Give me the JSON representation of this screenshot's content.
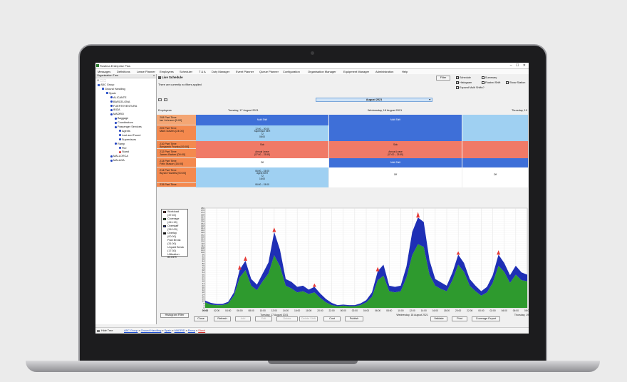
{
  "app": {
    "title": "Rostima Enterprise Plus",
    "icon": "app-icon",
    "window_controls": "–  ☐  ✕"
  },
  "menu": [
    "Messages",
    "Definitions",
    "Leave Planner",
    "Employees",
    "Scheduler",
    "T & A",
    "Duty Manager",
    "Event Planner",
    "Queue Planner",
    "Configuration",
    "Organisation Manager",
    "Equipment Manager",
    "Administration",
    "Help"
  ],
  "tree": {
    "header": "Organisation Tree",
    "close": "x",
    "tools": "⊕ ⬚ ⬚",
    "nodes": [
      {
        "label": "ABC Group",
        "depth": 0,
        "icon": "folder"
      },
      {
        "label": "Ground Handling",
        "depth": 1,
        "icon": "folder"
      },
      {
        "label": "Spain",
        "depth": 2,
        "icon": "folder"
      },
      {
        "label": "ALICANTE",
        "depth": 3,
        "icon": "dot"
      },
      {
        "label": "BARCELONA",
        "depth": 3,
        "icon": "dot"
      },
      {
        "label": "FUERTEVENTURA",
        "depth": 3,
        "icon": "dot"
      },
      {
        "label": "IBIZA",
        "depth": 3,
        "icon": "dot"
      },
      {
        "label": "MADRID",
        "depth": 3,
        "icon": "dot"
      },
      {
        "label": "Baggage",
        "depth": 4,
        "icon": "dot"
      },
      {
        "label": "Coordinators",
        "depth": 4,
        "icon": "dot"
      },
      {
        "label": "Passenger Services",
        "depth": 4,
        "icon": "dot"
      },
      {
        "label": "Agents",
        "depth": 5,
        "icon": "dot"
      },
      {
        "label": "Lost and Found",
        "depth": 5,
        "icon": "dot"
      },
      {
        "label": "Supervisors",
        "depth": 5,
        "icon": "dot"
      },
      {
        "label": "Ramp",
        "depth": 4,
        "icon": "dot"
      },
      {
        "label": "Pier",
        "depth": 5,
        "icon": "dot"
      },
      {
        "label": "Stand",
        "depth": 5,
        "icon": "red"
      },
      {
        "label": "MALLORCA",
        "depth": 3,
        "icon": "dot"
      },
      {
        "label": "MALAGA",
        "depth": 3,
        "icon": "dot"
      }
    ]
  },
  "schedule": {
    "title": "Live Schedule",
    "filter_message": "There are currently no filters applied",
    "filter_button": "Filter",
    "options": [
      {
        "label": "Schedule",
        "checked": true
      },
      {
        "label": "Summary",
        "checked": false
      },
      {
        "label": "Histogram",
        "checked": true
      },
      {
        "label": "Floated Shift",
        "checked": false
      },
      {
        "label": "Show Station",
        "checked": false
      },
      {
        "label": "Expand Multi Shifts?",
        "checked": false
      }
    ],
    "month": "August 2021",
    "employees_header": "Employees",
    "day_headers": [
      "Tuesday, 17 August 2021",
      "Wednesday, 18 August 2021",
      "Thursday, 19"
    ],
    "employees": [
      {
        "line1": "208 Part Time",
        "line2": "Ian Johnson [0:00]"
      },
      {
        "line1": "209 Part Time",
        "line2": "Mark Davies [24:00]"
      },
      {
        "line1": "210 Part Time",
        "line2": "Benjamin Franks [00:00]"
      },
      {
        "line1": "212 Part Time",
        "line2": "James Barker [00:00]"
      },
      {
        "line1": "213 Part Time",
        "line2": "Felix Mason [16:00]"
      },
      {
        "line1": "214 Part Time",
        "line2": "Bryan Howells [00:00]"
      },
      {
        "line1": "215 Part Time",
        "line2": ""
      }
    ],
    "shift_text": {
      "multi_shift": "Multi Shift",
      "sick": "Sick",
      "annual_leave": "Annual Leave",
      "annual_time": "[07:00 – 23:59]",
      "off": "Off",
      "sup_lines": [
        "12:00 – 20:00",
        "Supervisor KEH",
        "T2",
        "08:00"
      ],
      "agent_lines": [
        "06:00 – 15:00",
        "Agent KEH",
        "T2",
        "16:00"
      ],
      "cut_time": "06:00 – 15:00"
    }
  },
  "legend": [
    {
      "label": "Workload",
      "value": "(37:40)",
      "color": "#e53935"
    },
    {
      "label": "Coverage",
      "value": "(411:15)",
      "color": "#2e9a2e"
    },
    {
      "label": "Overstaff",
      "value": "(310:00)",
      "color": "#1e2fb5"
    },
    {
      "label": "Overlay",
      "value": "(00:00)",
      "color": "#111111"
    },
    {
      "label": "Paid Break",
      "value": "(31:00)",
      "color": ""
    },
    {
      "label": "Unpaid Break",
      "value": "(17:30)",
      "color": ""
    },
    {
      "label": "Utilization: 80.81%",
      "value": "",
      "color": ""
    }
  ],
  "histogram_filter": "Histogram Filter",
  "chart_data": {
    "type": "area",
    "title": "",
    "xlabel": "",
    "ylabel": "",
    "ylim": [
      0,
      180
    ],
    "yticks": [
      0,
      4,
      8,
      12,
      16,
      20,
      24,
      28,
      32,
      36,
      40,
      44,
      48,
      52,
      56,
      60,
      64,
      68,
      72,
      76,
      80,
      84,
      88,
      92,
      96,
      100,
      104,
      108,
      112,
      116,
      120,
      124,
      128,
      132,
      136,
      140,
      144,
      148,
      152,
      156,
      160,
      164,
      168,
      172,
      176,
      180
    ],
    "x_labels": [
      "00:00",
      "02:00",
      "04:00",
      "06:00",
      "08:00",
      "10:00",
      "12:00",
      "14:00",
      "16:00",
      "18:00",
      "20:00",
      "22:00",
      "00:00",
      "02:00",
      "04:00",
      "06:00",
      "08:00",
      "10:00",
      "12:00",
      "14:00",
      "16:00",
      "18:00",
      "20:00",
      "22:00",
      "00:00",
      "02:00",
      "04:00",
      "06:00",
      "08:00"
    ],
    "day_labels": [
      "Tuesday, 17 August 2021",
      "Wednesday, 18 August 2021",
      "Thursday, 19"
    ],
    "x_hours": [
      0,
      1,
      2,
      3,
      4,
      5,
      6,
      7,
      8,
      9,
      10,
      11,
      12,
      13,
      14,
      15,
      16,
      17,
      18,
      19,
      20,
      21,
      22,
      23,
      24,
      25,
      26,
      27,
      28,
      29,
      30,
      31,
      32,
      33,
      34,
      35,
      36,
      37,
      38,
      39,
      40,
      41,
      42,
      43,
      44,
      45,
      46,
      47,
      48,
      49,
      50,
      51,
      52,
      53,
      54,
      55,
      56
    ],
    "series": [
      {
        "name": "Coverage",
        "color": "#2e9a2e",
        "values": [
          10,
          6,
          5,
          5,
          8,
          22,
          55,
          68,
          40,
          32,
          48,
          62,
          95,
          75,
          40,
          35,
          28,
          30,
          25,
          28,
          18,
          10,
          5,
          3,
          4,
          3,
          3,
          5,
          10,
          20,
          50,
          58,
          30,
          28,
          30,
          55,
          95,
          115,
          110,
          60,
          40,
          34,
          30,
          50,
          78,
          65,
          40,
          30,
          22,
          28,
          45,
          76,
          65,
          45,
          60,
          50,
          48
        ]
      },
      {
        "name": "Overstaff",
        "color": "#1e2fb5",
        "values": [
          3,
          3,
          2,
          2,
          3,
          6,
          14,
          17,
          12,
          10,
          14,
          20,
          42,
          30,
          12,
          12,
          10,
          10,
          8,
          10,
          8,
          6,
          4,
          2,
          2,
          2,
          2,
          3,
          4,
          8,
          16,
          20,
          10,
          10,
          10,
          20,
          42,
          48,
          45,
          26,
          12,
          12,
          10,
          14,
          18,
          16,
          12,
          10,
          8,
          10,
          14,
          20,
          16,
          14,
          16,
          14,
          12
        ]
      },
      {
        "name": "Workload",
        "color": "#e53935",
        "values": [
          0,
          0,
          0,
          0,
          0,
          0,
          8,
          8,
          0,
          0,
          0,
          0,
          8,
          0,
          0,
          0,
          0,
          0,
          0,
          6,
          0,
          0,
          0,
          0,
          0,
          0,
          0,
          0,
          0,
          0,
          8,
          0,
          0,
          0,
          0,
          0,
          0,
          10,
          0,
          0,
          0,
          0,
          0,
          0,
          6,
          0,
          0,
          0,
          0,
          0,
          0,
          8,
          0,
          0,
          0,
          0,
          0
        ]
      }
    ],
    "grid": true,
    "legend": "left"
  },
  "buttons": [
    {
      "label": "Close",
      "enabled": true
    },
    {
      "label": "Refresh",
      "enabled": true
    },
    {
      "label": "Add",
      "enabled": false
    },
    {
      "label": "Edit",
      "enabled": false
    },
    {
      "label": "Delete",
      "enabled": false
    },
    {
      "label": "Delete Shift",
      "enabled": false
    },
    {
      "label": "Cost",
      "enabled": true
    },
    {
      "label": "Publish",
      "enabled": true
    },
    {
      "label": "Validate",
      "enabled": true
    },
    {
      "label": "Print",
      "enabled": true
    },
    {
      "label": "Coverage Export",
      "enabled": true
    }
  ],
  "status": {
    "hide_tree": "Hide Tree",
    "breadcrumb": [
      "ABC Group",
      "Ground Handling",
      "Spain",
      "MADRID",
      "Ramp",
      "Stand"
    ],
    "separator": "»"
  }
}
